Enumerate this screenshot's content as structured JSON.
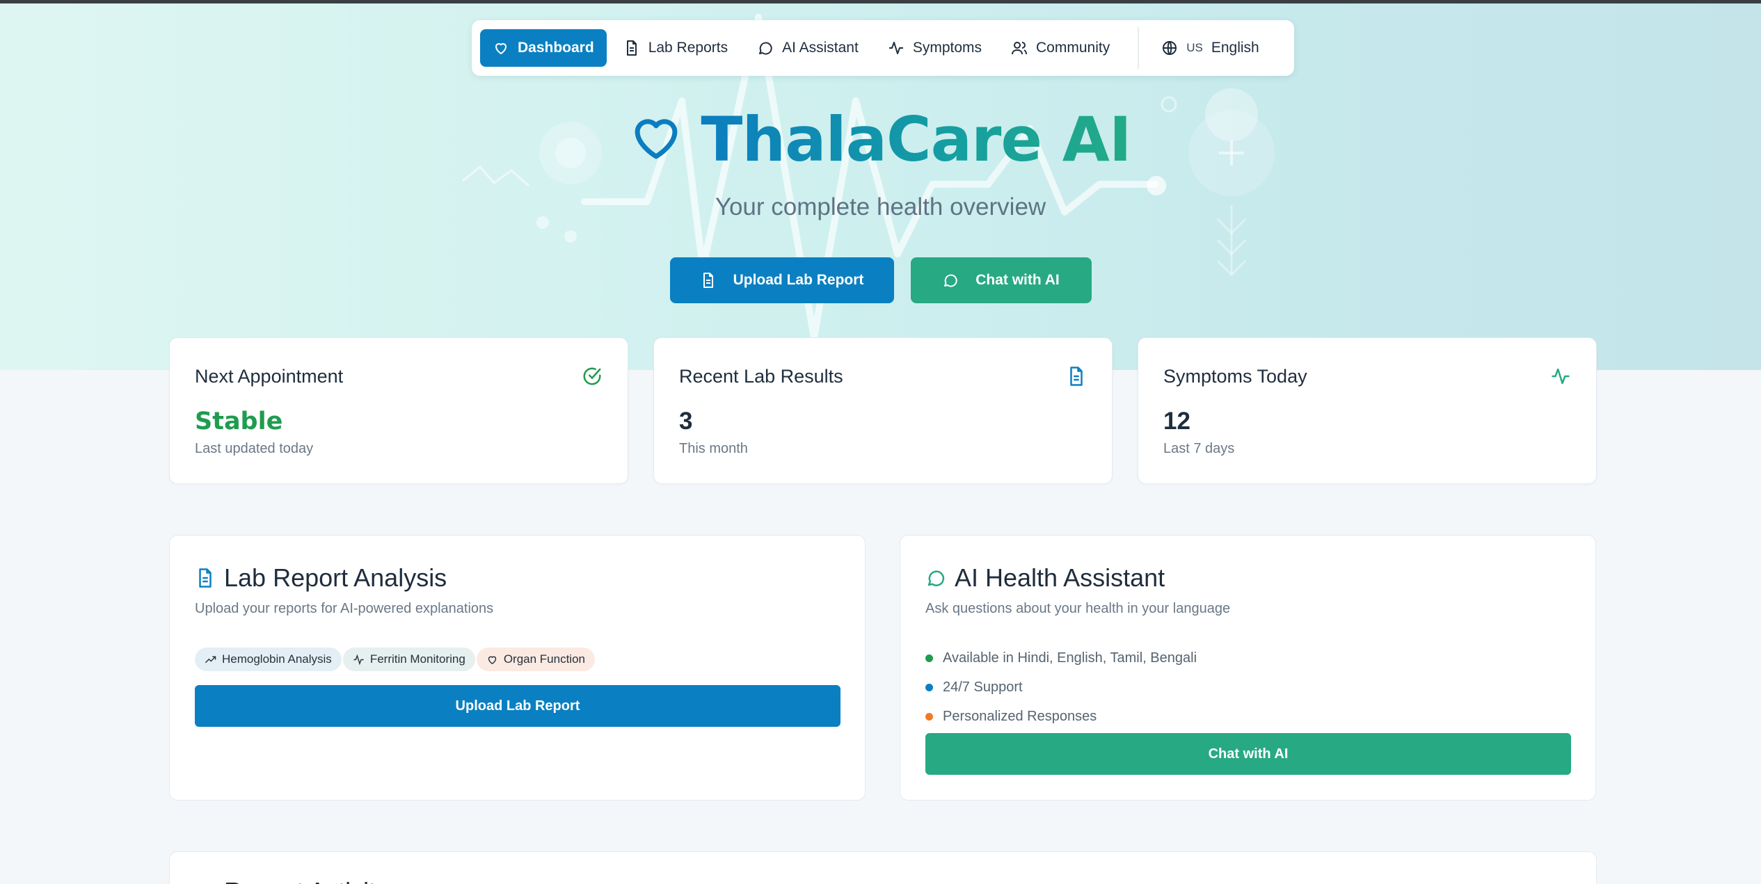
{
  "nav": {
    "items": [
      {
        "label": "Dashboard",
        "icon": "heart-icon",
        "active": true
      },
      {
        "label": "Lab Reports",
        "icon": "document-icon"
      },
      {
        "label": "AI Assistant",
        "icon": "chat-icon"
      },
      {
        "label": "Symptoms",
        "icon": "activity-icon"
      },
      {
        "label": "Community",
        "icon": "users-icon"
      }
    ],
    "language": {
      "flag": "US",
      "label": "English",
      "icon": "globe-icon"
    }
  },
  "hero": {
    "title": "ThalaCare AI",
    "subtitle": "Your complete health overview",
    "upload_button": "Upload Lab Report",
    "chat_button": "Chat with AI"
  },
  "stats": [
    {
      "title": "Next Appointment",
      "value": "Stable",
      "sub": "Last updated today",
      "icon": "check-circle-icon",
      "color": "#1f9c4f"
    },
    {
      "title": "Recent Lab Results",
      "value": "3",
      "sub": "This month",
      "icon": "document-icon",
      "color": "#0a80c2"
    },
    {
      "title": "Symptoms Today",
      "value": "12",
      "sub": "Last 7 days",
      "icon": "activity-icon",
      "color": "#27a983"
    }
  ],
  "lab_card": {
    "title": "Lab Report Analysis",
    "desc": "Upload your reports for AI-powered explanations",
    "chips": [
      "Hemoglobin Analysis",
      "Ferritin Monitoring",
      "Organ Function"
    ],
    "button": "Upload Lab Report"
  },
  "ai_card": {
    "title": "AI Health Assistant",
    "desc": "Ask questions about your health in your language",
    "bullets": [
      {
        "text": "Available in Hindi, English, Tamil, Bengali",
        "color": "#1f9c4f"
      },
      {
        "text": "24/7 Support",
        "color": "#0a80c2"
      },
      {
        "text": "Personalized Responses",
        "color": "#f07a26"
      }
    ],
    "button": "Chat with AI"
  },
  "bottom_card": {
    "title": "Recent Activity"
  },
  "colors": {
    "primary": "#0a80c2",
    "accent": "#27a983",
    "success": "#1f9c4f"
  }
}
